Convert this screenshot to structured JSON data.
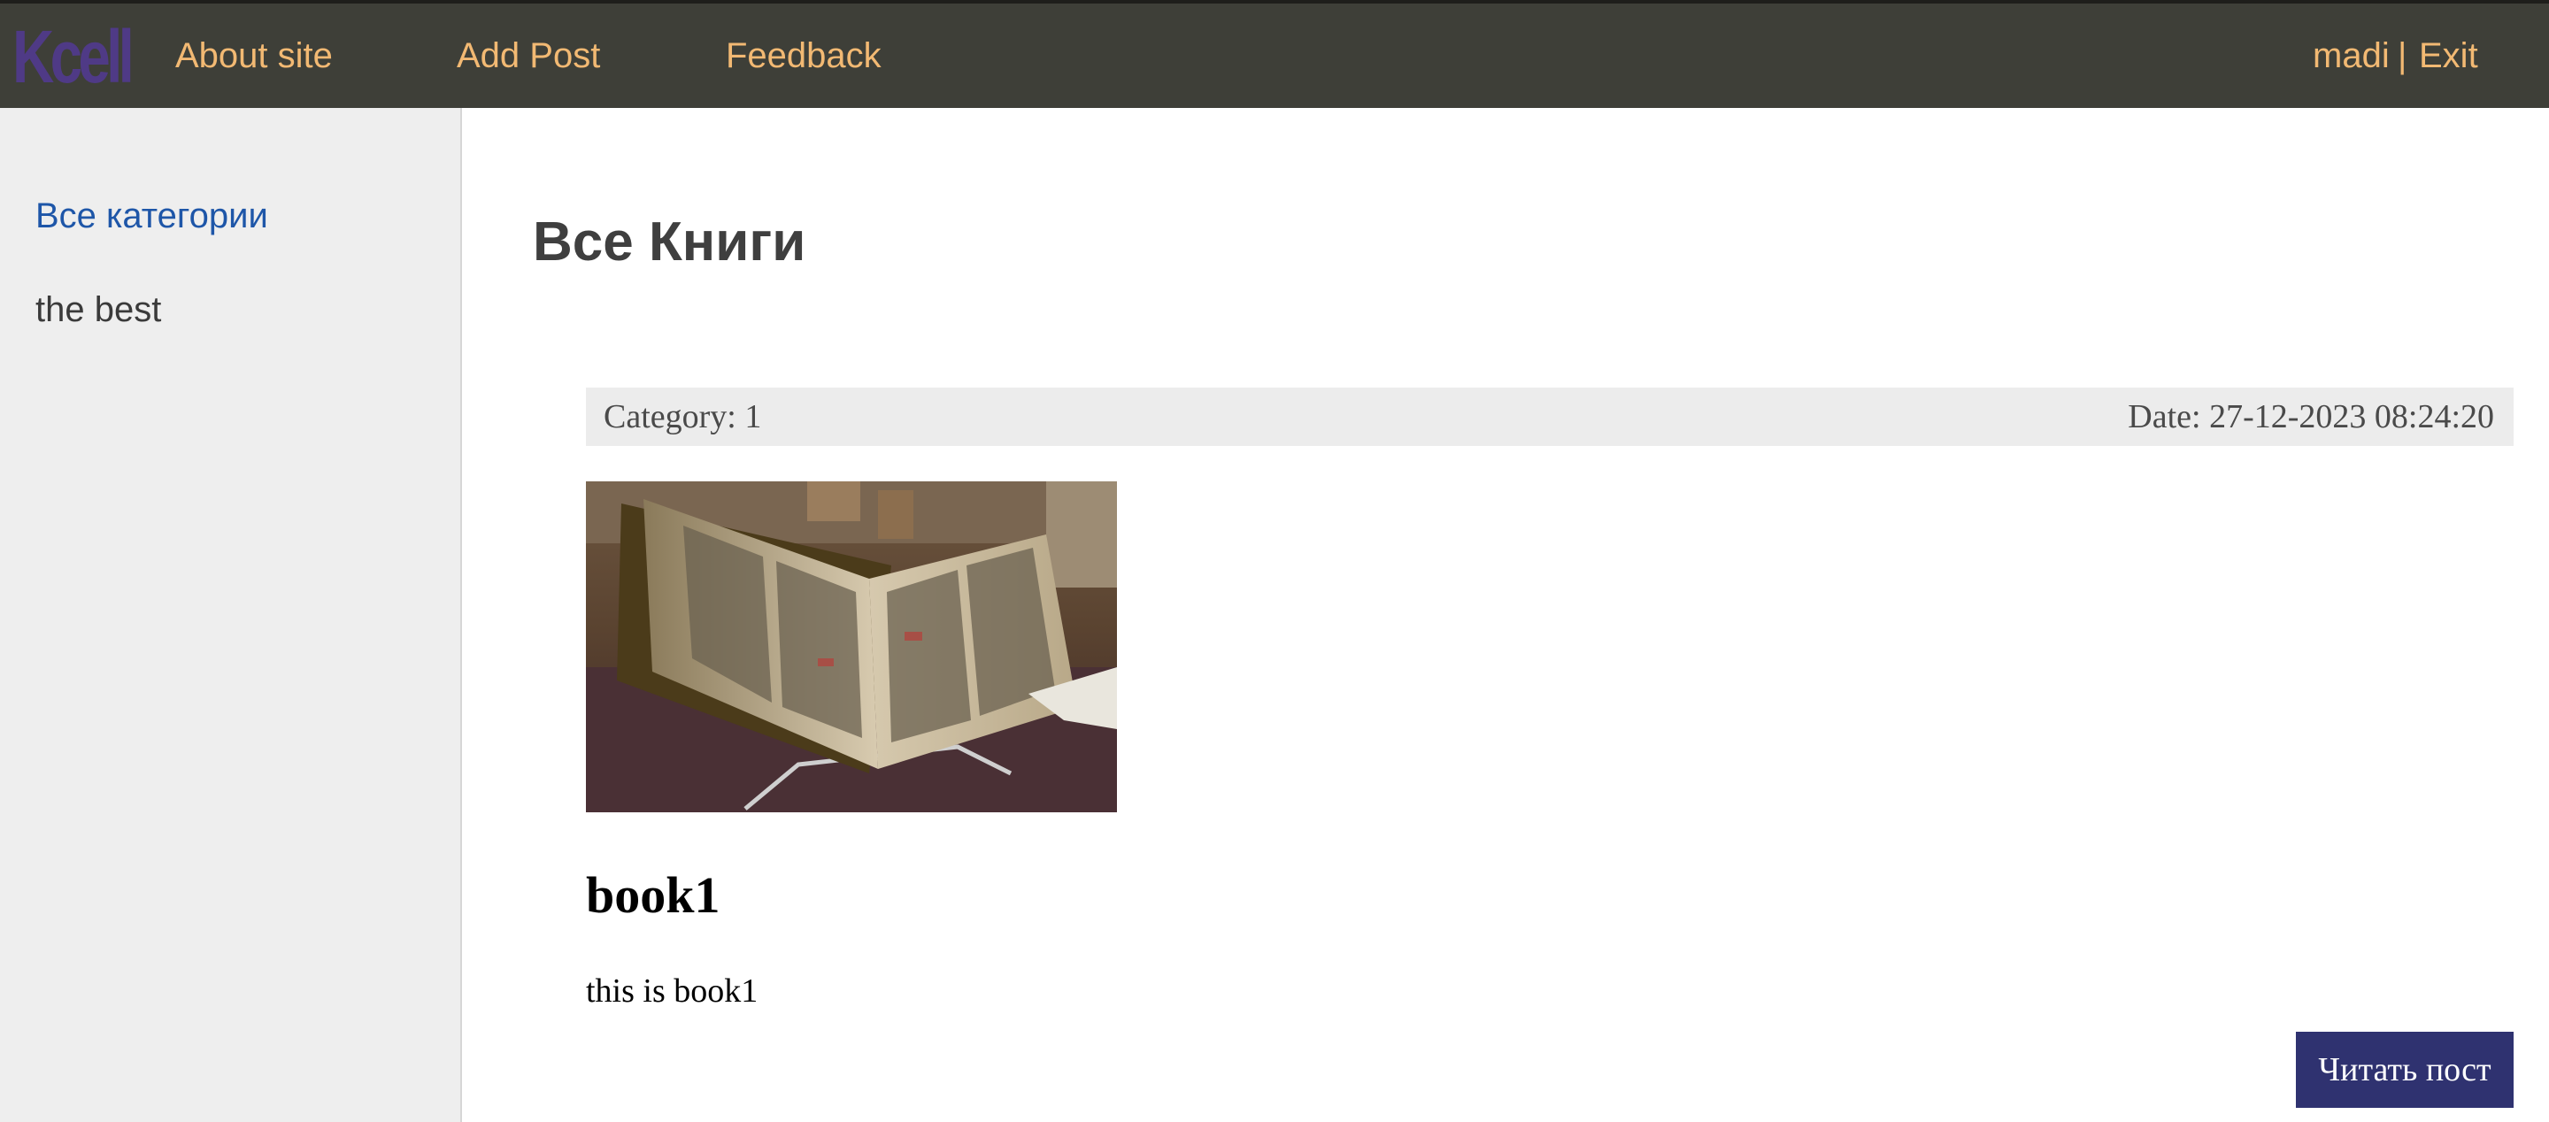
{
  "header": {
    "logo_text": "Kcell",
    "nav": {
      "about": "About site",
      "add_post": "Add Post",
      "feedback": "Feedback"
    },
    "user": "madi",
    "separator": "|",
    "exit": "Exit"
  },
  "sidebar": {
    "items": [
      {
        "label": "Все категории"
      },
      {
        "label": "the best"
      }
    ]
  },
  "main": {
    "title": "Все Книги",
    "post": {
      "category": "Category: 1",
      "date": "Date: 27-12-2023 08:24:20",
      "image_alt": "open book",
      "title": "book1",
      "text": "this is book1",
      "read_button": "Читать пост"
    }
  },
  "colors": {
    "topbar_bg": "#3e3f38",
    "nav_link": "#f2b973",
    "logo": "#4f3a86",
    "sidebar_bg": "#eeeeee",
    "sidebar_active": "#1e56a8",
    "button_bg": "#2f3270"
  }
}
